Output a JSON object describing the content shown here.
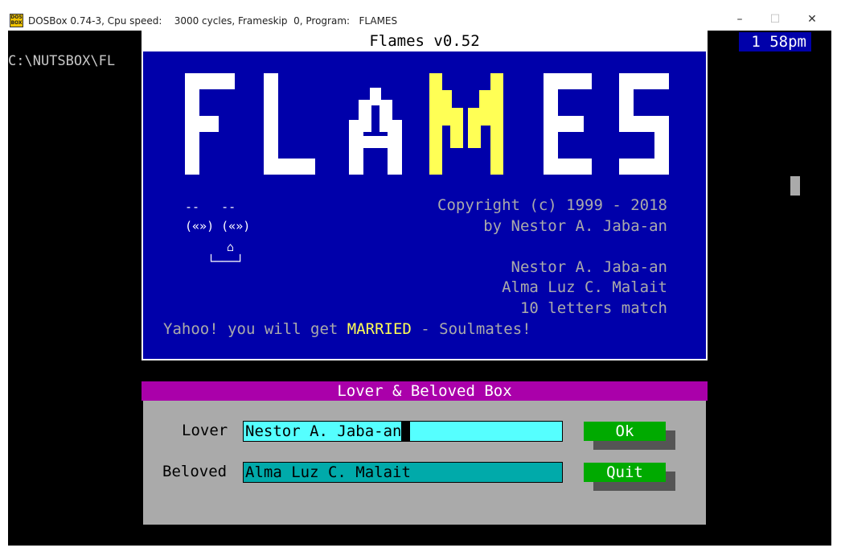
{
  "window": {
    "app_icon": "dosbox-icon",
    "title": "DOSBox 0.74-3, Cpu speed:    3000 cycles, Frameskip  0, Program:   FLAMES",
    "controls": {
      "minimize": "–",
      "maximize": "☐",
      "close": "✕"
    }
  },
  "dos": {
    "prompt": "C:\\NUTSBOX\\FL",
    "clock": "1 58pm"
  },
  "flames": {
    "title": "Flames v0.52",
    "logo": [
      "F",
      "L",
      "A",
      "M",
      "E",
      "S"
    ],
    "copyright": "Copyright (c) 1999 - 2018",
    "author": "by Nestor A. Jaba-an",
    "face": {
      "brows": "--   --",
      "eyes": "(«») («»)",
      "nose": "⌂",
      "mouth": "└───┘"
    },
    "lover_name": "Nestor A. Jaba-an",
    "beloved_name": "Alma Luz C. Malait",
    "match_text": "10 letters match",
    "result_prefix": "Yahoo! you will get ",
    "result_word": "MARRIED",
    "result_suffix": " - Soulmates!"
  },
  "dialog": {
    "header": "Lover & Beloved Box",
    "lover_label": "Lover",
    "beloved_label": "Beloved",
    "lover_value": "Nestor A. Jaba-an",
    "beloved_value": "Alma Luz C. Malait",
    "ok_label": "Ok",
    "quit_label": "Quit"
  },
  "colors": {
    "dos_blue": "#0000aa",
    "highlight_yellow": "#ffff55",
    "magenta": "#aa00aa",
    "button_green": "#00aa00",
    "field_cyan": "#55ffff"
  }
}
